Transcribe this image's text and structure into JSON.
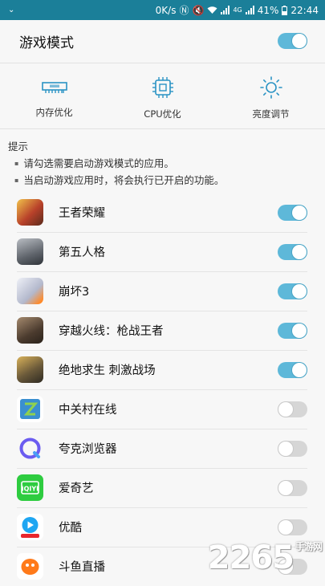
{
  "status_bar": {
    "left_icon": "down-chevron-icon",
    "speed": "0K/s",
    "battery": "41%",
    "network": "4G",
    "time": "22:44"
  },
  "header": {
    "title": "游戏模式",
    "toggle_on": true
  },
  "tools": [
    {
      "label": "内存优化",
      "icon": "memory-icon"
    },
    {
      "label": "CPU优化",
      "icon": "cpu-icon"
    },
    {
      "label": "亮度调节",
      "icon": "brightness-icon"
    }
  ],
  "hint": {
    "title": "提示",
    "lines": [
      "请勾选需要启动游戏模式的应用。",
      "当启动游戏应用时，将会执行已开启的功能。"
    ]
  },
  "apps": [
    {
      "name": "王者荣耀",
      "on": true,
      "color": "#c9892d"
    },
    {
      "name": "第五人格",
      "on": true,
      "color": "#7a7f86"
    },
    {
      "name": "崩坏3",
      "on": true,
      "color": "#c8ccd8"
    },
    {
      "name": "穿越火线：枪战王者",
      "on": true,
      "color": "#5a4a3a"
    },
    {
      "name": "绝地求生 刺激战场",
      "on": true,
      "color": "#6b5a3a"
    },
    {
      "name": "中关村在线",
      "on": false,
      "color": "#3a8fd0"
    },
    {
      "name": "夸克浏览器",
      "on": false,
      "color": "#6b5cf0"
    },
    {
      "name": "爱奇艺",
      "on": false,
      "color": "#2ecc40"
    },
    {
      "name": "优酷",
      "on": false,
      "color": "#1ea6f2"
    },
    {
      "name": "斗鱼直播",
      "on": false,
      "color": "#ff7a1a"
    }
  ],
  "watermark": {
    "text": "2265",
    "suffix": "手游网"
  },
  "colors": {
    "status_bar": "#1b7f99",
    "toggle_on": "#5eb8d9",
    "toggle_off": "#d6d6d6"
  }
}
